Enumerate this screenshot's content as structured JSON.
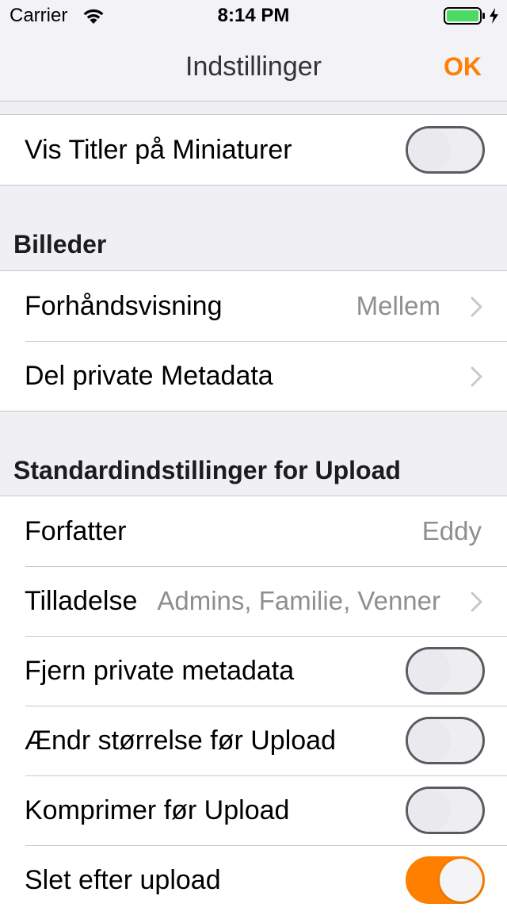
{
  "status_bar": {
    "carrier": "Carrier",
    "time": "8:14 PM",
    "wifi_icon": "wifi-icon",
    "battery_icon": "battery-charging-icon",
    "battery_color": "#4cd964"
  },
  "nav": {
    "title": "Indstillinger",
    "done_label": "OK",
    "accent_color": "#ff7f00"
  },
  "display_section": {
    "rows": [
      {
        "label": "Vis Titler på Miniaturer",
        "control": "switch",
        "on": false
      }
    ]
  },
  "images_section": {
    "header": "Billeder",
    "rows": [
      {
        "label": "Forhåndsvisning",
        "value": "Mellem",
        "control": "disclosure"
      },
      {
        "label": "Del private Metadata",
        "control": "disclosure"
      }
    ]
  },
  "upload_section": {
    "header": "Standardindstillinger for Upload",
    "rows": [
      {
        "label": "Forfatter",
        "value": "Eddy"
      },
      {
        "label": "Tilladelse",
        "value": "Admins, Familie, Venner",
        "control": "disclosure"
      },
      {
        "label": "Fjern private metadata",
        "control": "switch",
        "on": false
      },
      {
        "label": "Ændr størrelse før Upload",
        "control": "switch",
        "on": false
      },
      {
        "label": "Komprimer før Upload",
        "control": "switch",
        "on": false
      },
      {
        "label": "Slet efter upload",
        "control": "switch",
        "on": true
      }
    ]
  }
}
